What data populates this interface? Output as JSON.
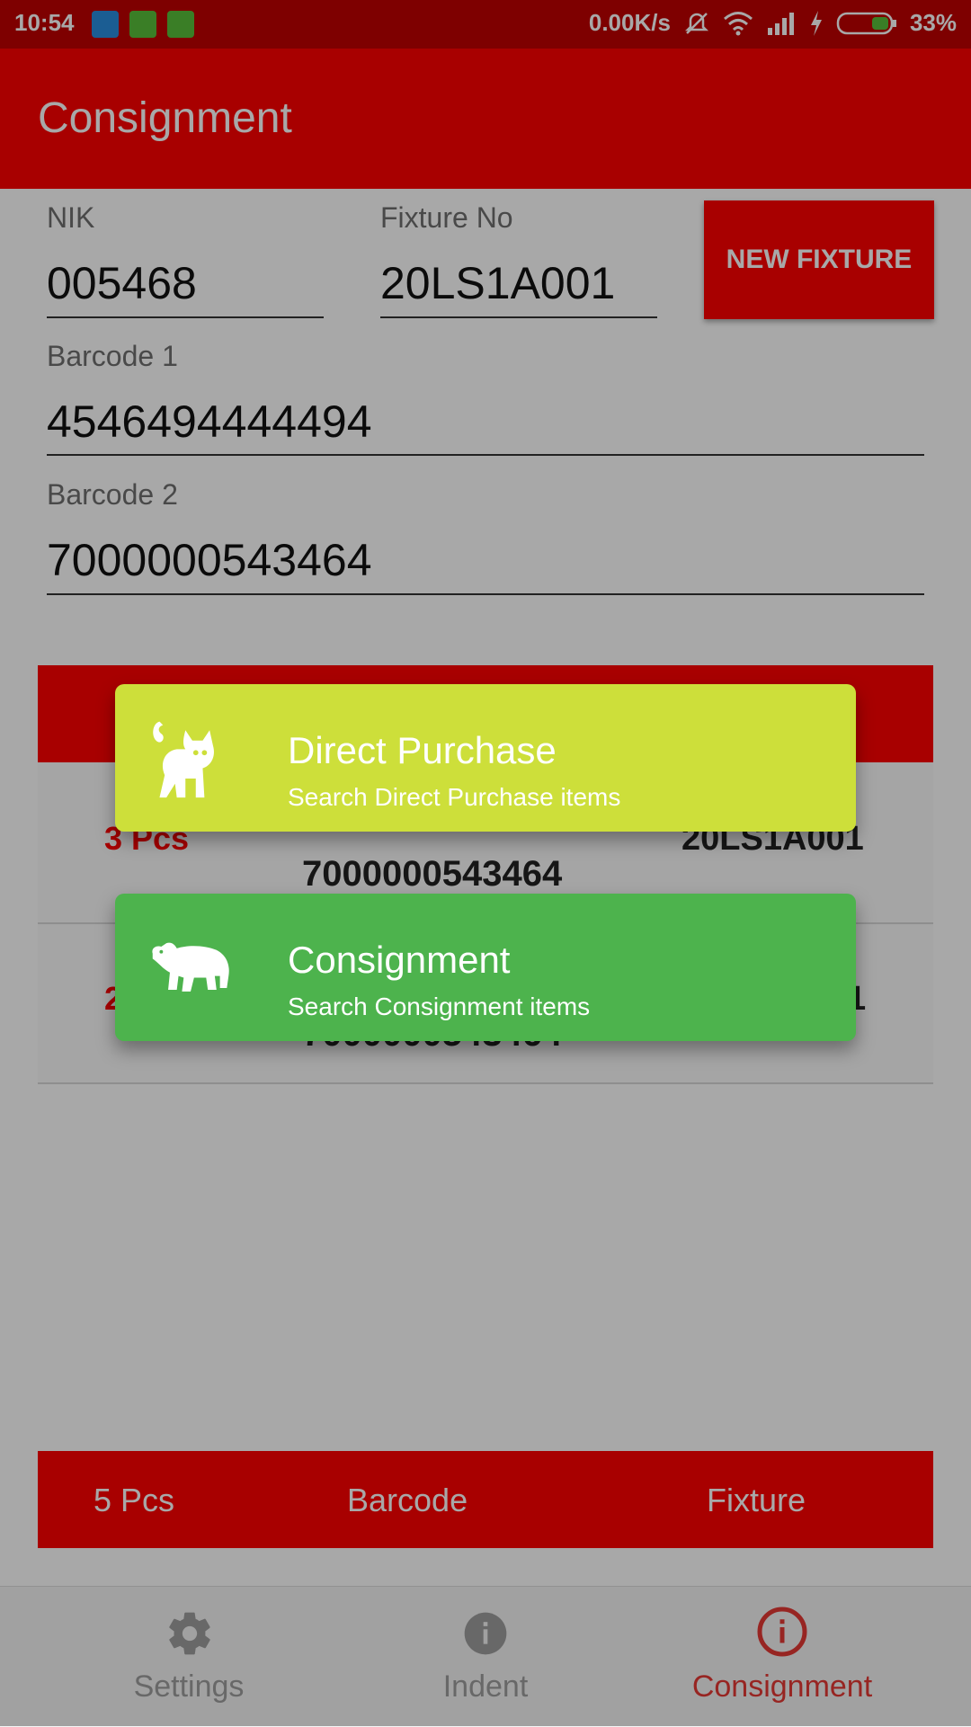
{
  "status_bar": {
    "time": "10:54",
    "network_speed": "0.00K/s",
    "battery_percent": "33%",
    "icons": [
      "usb-icon",
      "battery-saver-icon",
      "android-icon",
      "mute-icon",
      "wifi-icon",
      "signal-icon",
      "charging-icon",
      "battery-icon"
    ]
  },
  "app_bar": {
    "title": "Consignment"
  },
  "form": {
    "nik_label": "NIK",
    "nik_value": "005468",
    "fixture_label": "Fixture No",
    "fixture_value": "20LS1A001",
    "new_fixture_button": "NEW FIXTURE",
    "barcode1_label": "Barcode 1",
    "barcode1_value": "4546494444494",
    "barcode2_label": "Barcode 2",
    "barcode2_value": "7000000543464"
  },
  "list": {
    "rows": [
      {
        "qty": "3 Pcs",
        "barcode": "7000000543464",
        "fixture": "20LS1A001"
      },
      {
        "qty": "2",
        "barcode": "7000000543464",
        "fixture": "1"
      }
    ]
  },
  "dialog": {
    "options": [
      {
        "title": "Direct Purchase",
        "subtitle": "Search Direct Purchase items",
        "icon": "cat-icon",
        "color": "#cddf3a"
      },
      {
        "title": "Consignment",
        "subtitle": "Search Consignment items",
        "icon": "polar-bear-icon",
        "color": "#4db34d"
      }
    ]
  },
  "summary_bar": {
    "qty": "5 Pcs",
    "barcode_header": "Barcode",
    "fixture_header": "Fixture"
  },
  "bottom_nav": {
    "items": [
      {
        "label": "Settings",
        "icon": "gear-icon",
        "active": false
      },
      {
        "label": "Indent",
        "icon": "info-icon",
        "active": false
      },
      {
        "label": "Consignment",
        "icon": "info-outline-icon",
        "active": true
      }
    ]
  },
  "colors": {
    "primary": "#ff0000",
    "active_nav": "#e53935",
    "inactive_nav": "#9e9e9e"
  }
}
